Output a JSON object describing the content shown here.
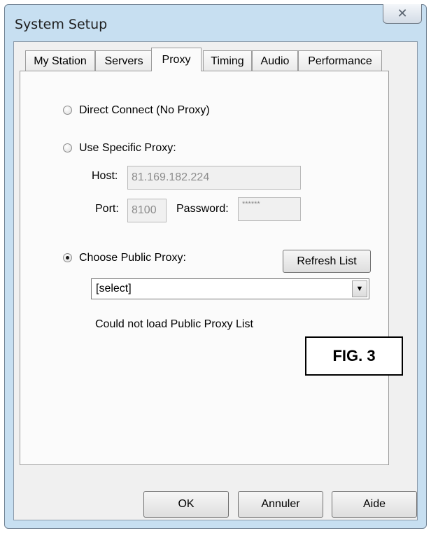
{
  "window": {
    "title": "System Setup",
    "close_glyph": "✕"
  },
  "tabs": [
    {
      "label": "My Station"
    },
    {
      "label": "Servers"
    },
    {
      "label": "Proxy",
      "active": true
    },
    {
      "label": "Timing"
    },
    {
      "label": "Audio"
    },
    {
      "label": "Performance"
    }
  ],
  "proxy": {
    "direct_label": "Direct Connect (No Proxy)",
    "specific_label": "Use Specific Proxy:",
    "host_label": "Host:",
    "host_value": "81.169.182.224",
    "port_label": "Port:",
    "port_value": "8100",
    "password_label": "Password:",
    "password_value": "******",
    "public_label": "Choose Public Proxy:",
    "refresh_label": "Refresh List",
    "select_value": "[select]",
    "status_text": "Could not load Public Proxy List",
    "selected_option": "Choose Public Proxy:"
  },
  "figure_label": "FIG. 3",
  "footer": {
    "ok_label": "OK",
    "cancel_label": "Annuler",
    "help_label": "Aide"
  },
  "colors": {
    "frame": "#c7dff1",
    "panel": "#fbfbfb",
    "client": "#f0f0f0"
  }
}
